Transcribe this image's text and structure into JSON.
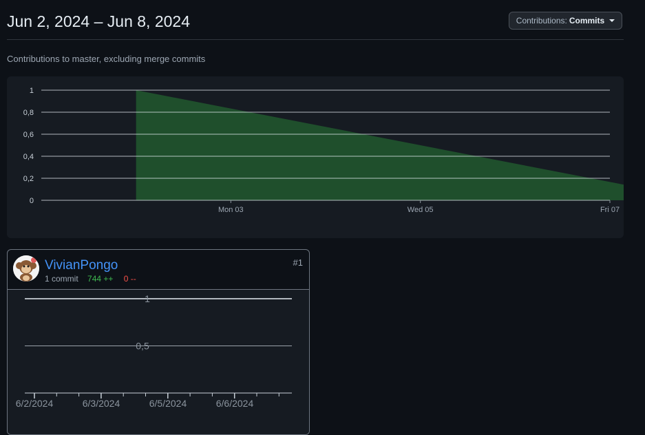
{
  "header": {
    "title": "Jun 2, 2024 – Jun 8, 2024",
    "dropdown_prefix": "Contributions:",
    "dropdown_value": "Commits"
  },
  "subtitle": "Contributions to master, excluding merge commits",
  "chart_data": [
    {
      "type": "area",
      "title": "",
      "xlabel": "",
      "ylabel": "",
      "x": [
        "2024-06-02",
        "2024-06-08"
      ],
      "y": [
        1,
        0
      ],
      "x_ticks": [
        "Mon 03",
        "Wed 05",
        "Fri 07"
      ],
      "y_ticks": [
        "0",
        "0,2",
        "0,4",
        "0,6",
        "0,8",
        "1"
      ],
      "ylim": [
        0,
        1
      ],
      "grid": true,
      "color": "#1f4f2c"
    },
    {
      "type": "line",
      "x_ticks": [
        "6/2/2024",
        "6/3/2024",
        "6/5/2024",
        "6/6/2024"
      ],
      "y_ticks": [
        "0,5",
        "1"
      ],
      "ylim": [
        0,
        1
      ],
      "grid": true
    }
  ],
  "contributors": [
    {
      "username": "VivianPongo",
      "commits": "1 commit",
      "additions": "744 ++",
      "deletions": "0 --",
      "rank": "#1"
    }
  ],
  "colors": {
    "background": "#0d1117",
    "panel": "#161b22",
    "area_fill": "#1f4f2c",
    "link": "#4493f8",
    "additions": "#3fb950",
    "deletions": "#f85149"
  }
}
